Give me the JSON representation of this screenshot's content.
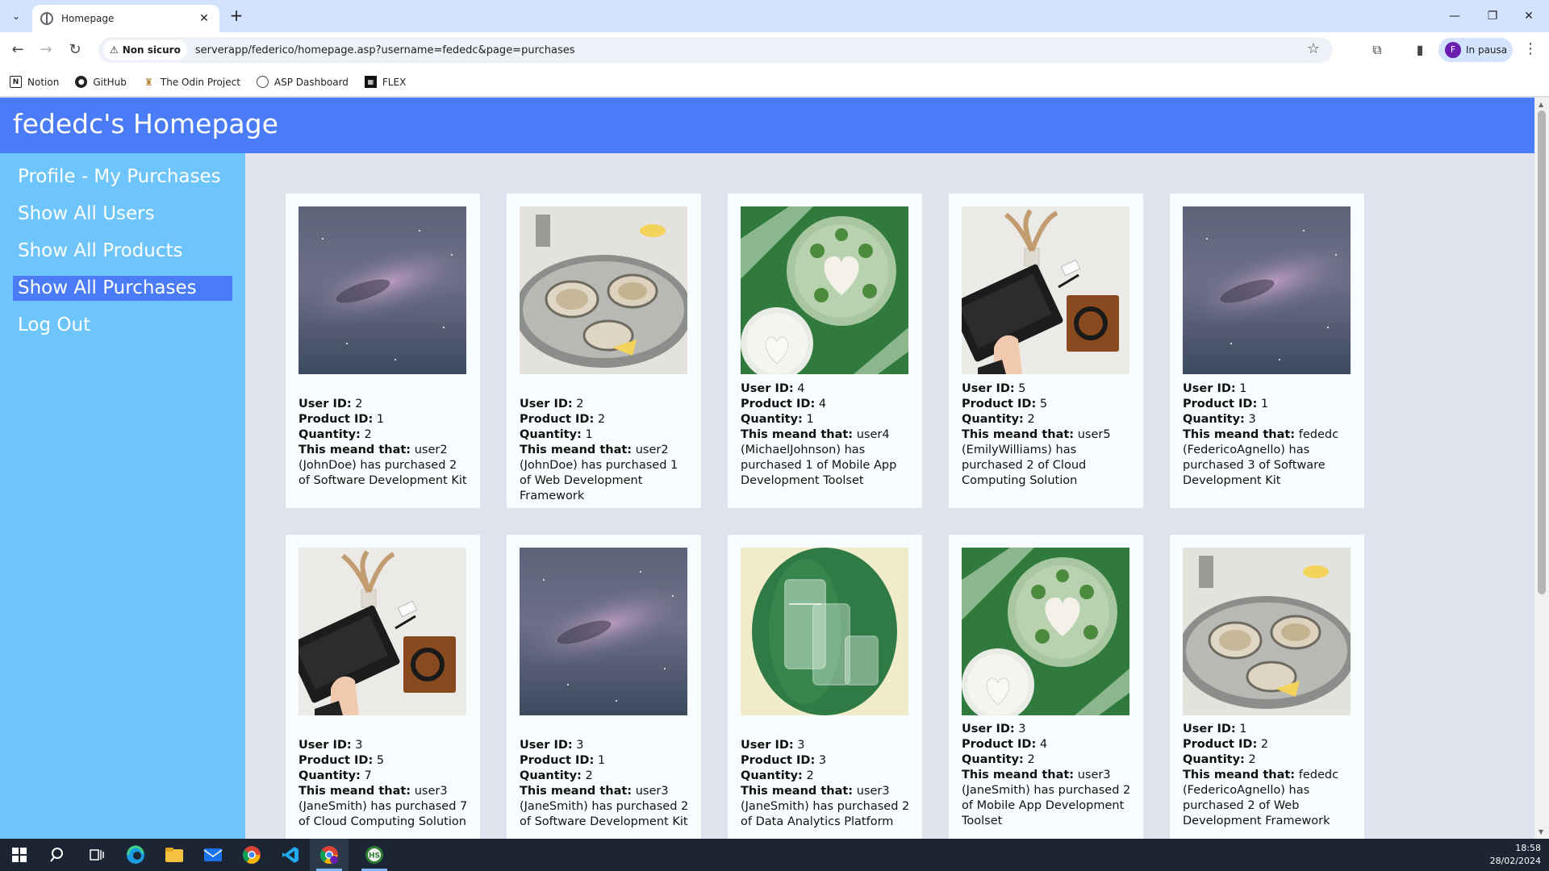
{
  "browser": {
    "tab_title": "Homepage",
    "new_tab_label": "+",
    "security_label": "Non sicuro",
    "url": "serverapp/federico/homepage.asp?username=fededc&page=purchases",
    "profile_initial": "F",
    "profile_status": "In pausa",
    "bookmarks": [
      {
        "label": "Notion",
        "icon": "notion-icon"
      },
      {
        "label": "GitHub",
        "icon": "github-icon"
      },
      {
        "label": "The Odin Project",
        "icon": "odin-icon"
      },
      {
        "label": "ASP Dashboard",
        "icon": "globe-icon"
      },
      {
        "label": "FLEX",
        "icon": "flex-icon"
      }
    ]
  },
  "site": {
    "title": "fededc's Homepage",
    "nav": [
      {
        "label": "Profile - My Purchases",
        "active": false
      },
      {
        "label": "Show All Users",
        "active": false
      },
      {
        "label": "Show All Products",
        "active": false
      },
      {
        "label": "Show All Purchases",
        "active": true
      },
      {
        "label": "Log Out",
        "active": false
      }
    ]
  },
  "field_labels": {
    "user_id": "User ID:",
    "product_id": "Product ID:",
    "quantity": "Quantity:",
    "meaning": "This meand that:"
  },
  "purchases": [
    {
      "user_id": "2",
      "product_id": "1",
      "quantity": "2",
      "text": "user2 (JohnDoe) has purchased 2 of Software Development Kit",
      "image": "galaxy"
    },
    {
      "user_id": "2",
      "product_id": "2",
      "quantity": "1",
      "text": "user2 (JohnDoe) has purchased 1 of Web Development Framework",
      "image": "oysters"
    },
    {
      "user_id": "4",
      "product_id": "4",
      "quantity": "1",
      "text": "user4 (MichaelJohnson) has purchased 1 of Mobile App Development Toolset",
      "image": "plate"
    },
    {
      "user_id": "5",
      "product_id": "5",
      "quantity": "2",
      "text": "user5 (EmilyWilliams) has purchased 2 of Cloud Computing Solution",
      "image": "laptop"
    },
    {
      "user_id": "1",
      "product_id": "1",
      "quantity": "3",
      "text": "fededc (FedericoAgnello) has purchased 3 of Software Development Kit",
      "image": "galaxy"
    },
    {
      "user_id": "3",
      "product_id": "5",
      "quantity": "7",
      "text": "user3 (JaneSmith) has purchased 7 of Cloud Computing Solution",
      "image": "laptop"
    },
    {
      "user_id": "3",
      "product_id": "1",
      "quantity": "2",
      "text": "user3 (JaneSmith) has purchased 2 of Software Development Kit",
      "image": "galaxy"
    },
    {
      "user_id": "3",
      "product_id": "3",
      "quantity": "2",
      "text": "user3 (JaneSmith) has purchased 2 of Data Analytics Platform",
      "image": "glasses"
    },
    {
      "user_id": "3",
      "product_id": "4",
      "quantity": "2",
      "text": "user3 (JaneSmith) has purchased 2 of Mobile App Development Toolset",
      "image": "plate"
    },
    {
      "user_id": "1",
      "product_id": "2",
      "quantity": "2",
      "text": "fededc (FedericoAgnello) has purchased 2 of Web Development Framework",
      "image": "oysters"
    }
  ],
  "taskbar": {
    "time": "18:58",
    "date": "28/02/2024",
    "apps": [
      "start-icon",
      "search-icon",
      "task-view-icon",
      "edge-icon",
      "file-explorer-icon",
      "mail-icon",
      "chrome-icon",
      "vscode-icon",
      "chrome-profile-icon",
      "hs-app-icon"
    ]
  },
  "colors": {
    "header": "#4a7cf7",
    "sidebar": "#6ec5fc",
    "active_nav": "#4a7cf7",
    "page_bg": "#dfe3ee",
    "card_bg": "#f7fdff"
  }
}
